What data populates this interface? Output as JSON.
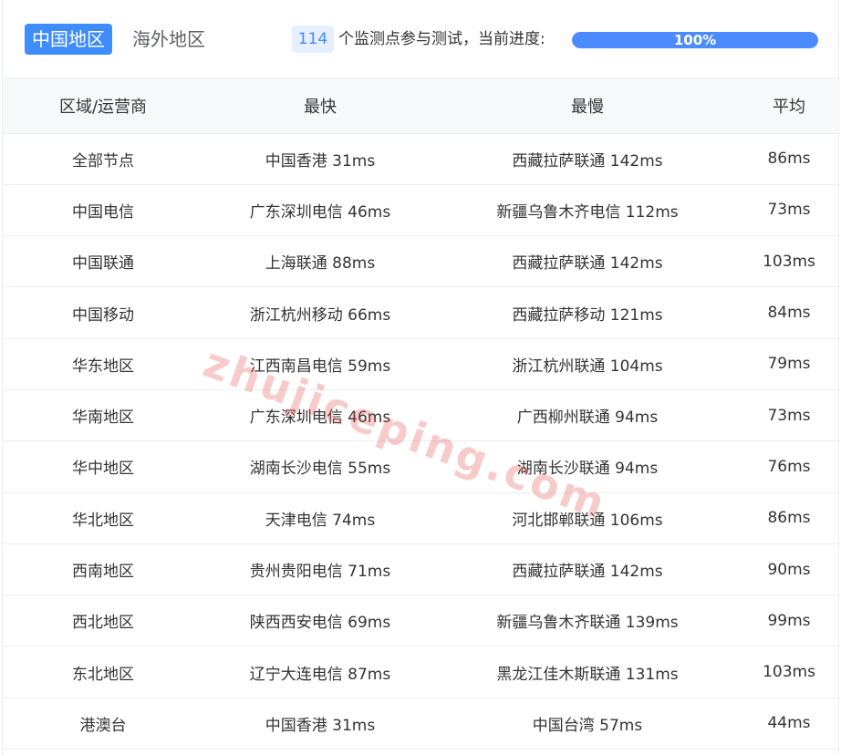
{
  "tabs": {
    "active": "中国地区",
    "inactive": "海外地区"
  },
  "progress": {
    "count": "114",
    "text": "个监测点参与测试，当前进度:",
    "percent_label": "100%",
    "percent": 100
  },
  "table": {
    "headers": [
      "区域/运营商",
      "最快",
      "最慢",
      "平均"
    ],
    "rows": [
      [
        "全部节点",
        "中国香港 31ms",
        "西藏拉萨联通 142ms",
        "86ms"
      ],
      [
        "中国电信",
        "广东深圳电信 46ms",
        "新疆乌鲁木齐电信 112ms",
        "73ms"
      ],
      [
        "中国联通",
        "上海联通 88ms",
        "西藏拉萨联通 142ms",
        "103ms"
      ],
      [
        "中国移动",
        "浙江杭州移动 66ms",
        "西藏拉萨移动 121ms",
        "84ms"
      ],
      [
        "华东地区",
        "江西南昌电信 59ms",
        "浙江杭州联通 104ms",
        "79ms"
      ],
      [
        "华南地区",
        "广东深圳电信 46ms",
        "广西柳州联通 94ms",
        "73ms"
      ],
      [
        "华中地区",
        "湖南长沙电信 55ms",
        "湖南长沙联通 94ms",
        "76ms"
      ],
      [
        "华北地区",
        "天津电信 74ms",
        "河北邯郸联通 106ms",
        "86ms"
      ],
      [
        "西南地区",
        "贵州贵阳电信 71ms",
        "西藏拉萨联通 142ms",
        "90ms"
      ],
      [
        "西北地区",
        "陕西西安电信 69ms",
        "新疆乌鲁木齐联通 139ms",
        "99ms"
      ],
      [
        "东北地区",
        "辽宁大连电信 87ms",
        "黑龙江佳木斯联通 131ms",
        "103ms"
      ],
      [
        "港澳台",
        "中国香港 31ms",
        "中国台湾 57ms",
        "44ms"
      ]
    ]
  },
  "watermark": "zhujiceping.com",
  "colors": {
    "accent": "#3f8cff",
    "badge_bg": "#e6efff",
    "header_bg": "#f7f8fa"
  }
}
